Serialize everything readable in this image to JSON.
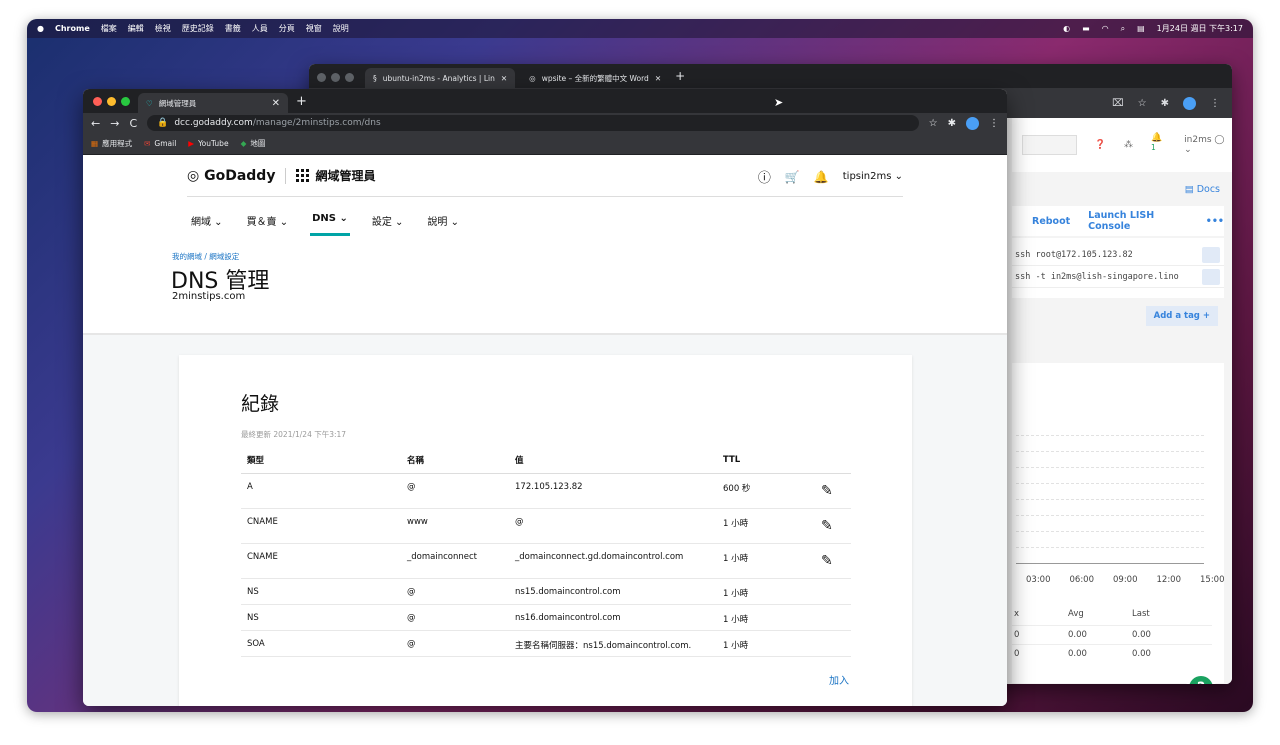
{
  "menubar": {
    "app": "Chrome",
    "items": [
      "檔案",
      "編輯",
      "檢視",
      "歷史記錄",
      "書籤",
      "人員",
      "分頁",
      "視窗",
      "說明"
    ],
    "clock": "1月24日 週日 下午3:17"
  },
  "back_window": {
    "tabs": [
      {
        "title": "ubuntu-in2ms - Analytics | Lin"
      },
      {
        "title": "wpsite – 全新的繁體中文 Word"
      }
    ],
    "user": "in2ms",
    "notif": "1",
    "docs": "Docs",
    "reboot": "Reboot",
    "lish": "Launch LISH Console",
    "ssh": [
      "ssh root@172.105.123.82",
      "ssh -t in2ms@lish-singapore.lino"
    ],
    "add_tag": "Add a tag",
    "times": [
      "03:00",
      "06:00",
      "09:00",
      "12:00",
      "15:00"
    ],
    "stats": {
      "headers": [
        "x",
        "Avg",
        "Last"
      ],
      "rows": [
        [
          "0",
          "0.00",
          "0.00"
        ],
        [
          "0",
          "0.00",
          "0.00"
        ]
      ]
    }
  },
  "front_window": {
    "tab_title": "網域管理員",
    "url_host": "dcc.godaddy.com",
    "url_path": "/manage/2minstips.com/dns",
    "bookmarks": [
      "應用程式",
      "Gmail",
      "YouTube",
      "地圖"
    ],
    "logo": "GoDaddy",
    "product": "網域管理員",
    "account": "tipsin2ms",
    "nav": [
      "網域",
      "買＆賣",
      "DNS",
      "設定",
      "說明"
    ],
    "breadcrumb": "我的網域 / 網域設定",
    "title": "DNS 管理",
    "domain": "2minstips.com",
    "card": {
      "title": "紀錄",
      "updated": "最終更新 2021/1/24 下午3:17",
      "headers": [
        "類型",
        "名稱",
        "值",
        "TTL"
      ],
      "records": [
        {
          "type": "A",
          "name": "@",
          "value": "172.105.123.82",
          "ttl": "600 秒",
          "editable": true
        },
        {
          "type": "CNAME",
          "name": "www",
          "value": "@",
          "ttl": "1 小時",
          "editable": true
        },
        {
          "type": "CNAME",
          "name": "_domainconnect",
          "value": "_domainconnect.gd.domaincontrol.com",
          "ttl": "1 小時",
          "editable": true
        },
        {
          "type": "NS",
          "name": "@",
          "value": "ns15.domaincontrol.com",
          "ttl": "1 小時",
          "editable": false
        },
        {
          "type": "NS",
          "name": "@",
          "value": "ns16.domaincontrol.com",
          "ttl": "1 小時",
          "editable": false
        },
        {
          "type": "SOA",
          "name": "@",
          "value": "主要名稱伺服器：ns15.domaincontrol.com.",
          "ttl": "1 小時",
          "editable": false
        }
      ],
      "add": "加入"
    }
  }
}
